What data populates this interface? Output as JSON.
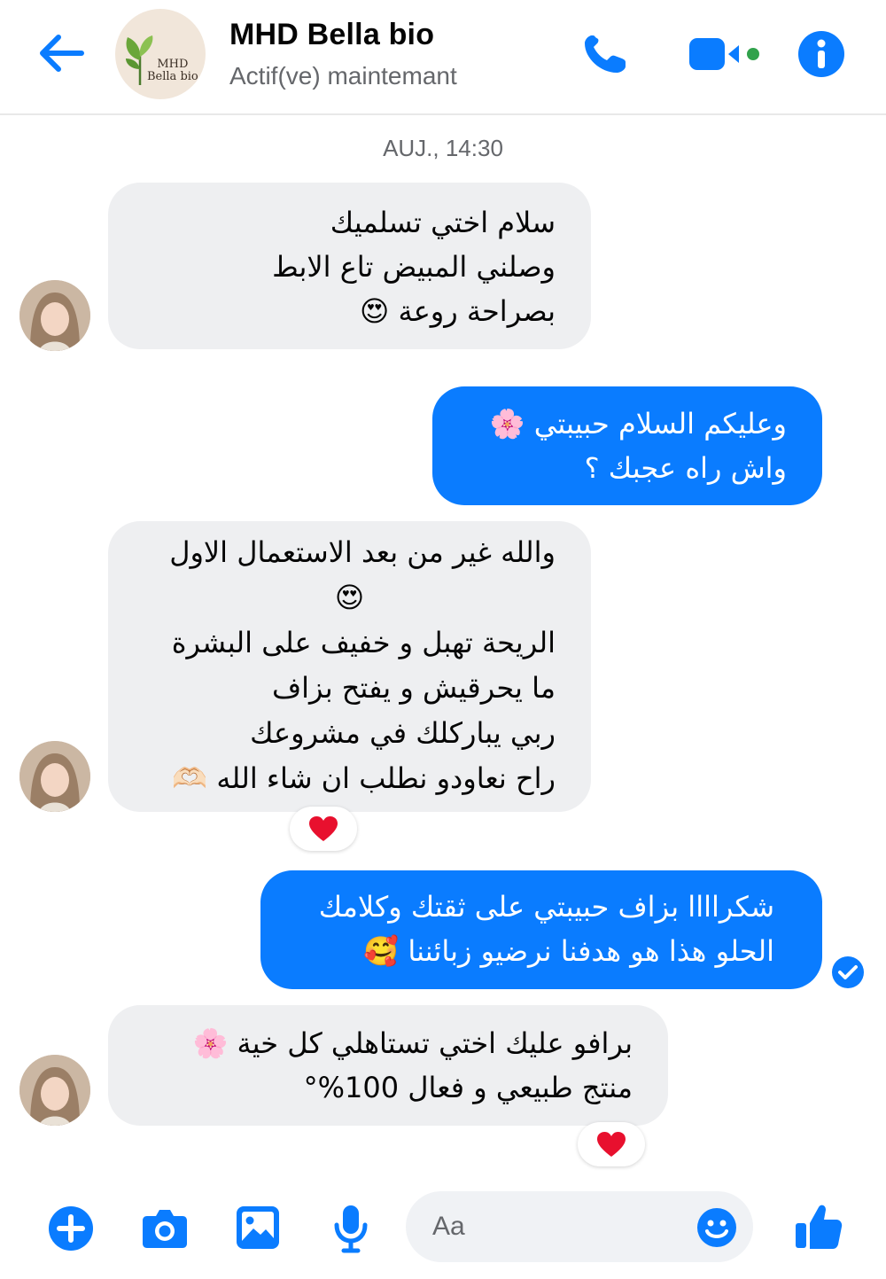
{
  "header": {
    "contact_name": "MHD Bella bio",
    "status": "Actif(ve) maintemant",
    "logo_text_line1": "MHD",
    "logo_text_line2": "Bella bio"
  },
  "timestamp": "AUJ., 14:30",
  "messages": [
    {
      "direction": "incoming",
      "lines": [
        "سلام اختي تسلميك",
        "وصلني المبيض تاع الابط",
        "بصراحة روعة 😍"
      ]
    },
    {
      "direction": "outgoing",
      "lines": [
        "وعليكم السلام حبيبتي 🌸",
        "واش راه عجبك ؟"
      ]
    },
    {
      "direction": "incoming",
      "lines": [
        "والله غير من بعد الاستعمال الاول",
        "😍",
        "الريحة تهبل و خفيف على البشرة",
        "ما يحرقيش و يفتح بزاف",
        "ربي يباركلك في مشروعك",
        "راح نعاودو نطلب ان شاء الله 🫶🏻"
      ],
      "reaction": "❤️"
    },
    {
      "direction": "outgoing",
      "lines": [
        "شكراااا بزاف حبيبتي على ثقتك وكلامك",
        "الحلو هذا هو هدفنا نرضيو زبائننا 🥰"
      ],
      "status": "seen"
    },
    {
      "direction": "incoming",
      "lines": [
        "برافو عليك اختي تستاهلي كل خية 🌸",
        "منتج طبيعي و فعال 100%°"
      ],
      "reaction": "❤️"
    }
  ],
  "composer": {
    "placeholder": "Aa"
  },
  "colors": {
    "accent": "#0a7cff",
    "incoming_bubble": "#eeeff1",
    "online_dot": "#31a24c"
  }
}
